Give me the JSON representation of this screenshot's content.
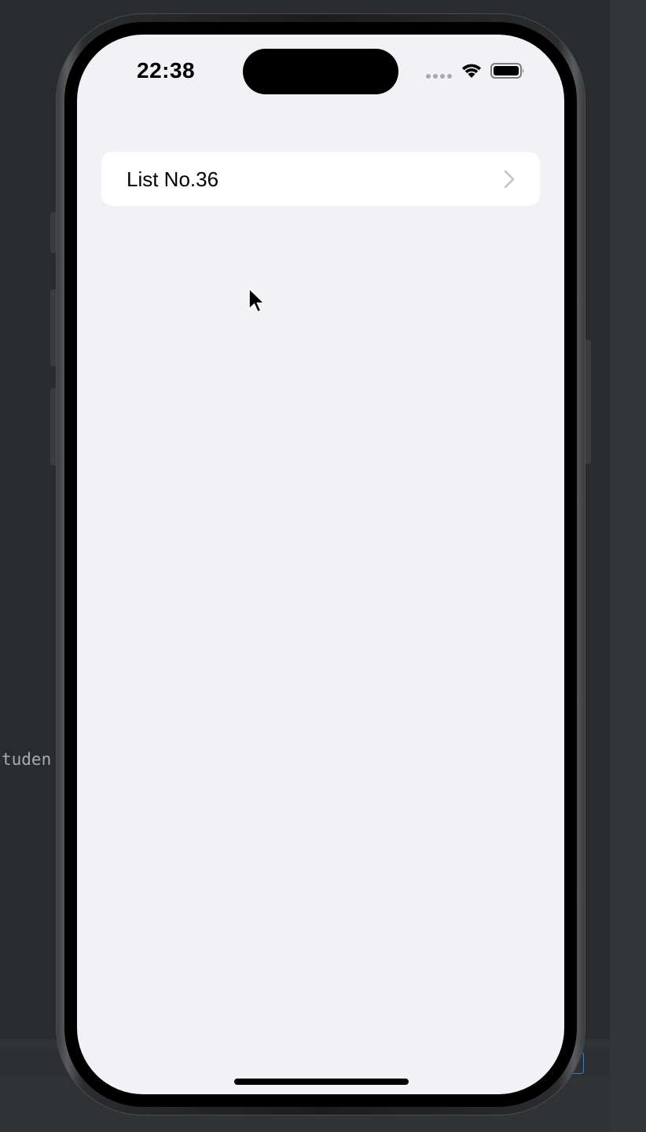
{
  "status_bar": {
    "time": "22:38",
    "signal_icon": "cellular-signal-icon",
    "wifi_icon": "wifi-icon",
    "battery_icon": "battery-full-icon"
  },
  "list": {
    "items": [
      {
        "label": "List No.36",
        "icon": "chevron-right-icon"
      }
    ]
  },
  "background_editor": {
    "code_fragment": "tuden"
  },
  "colors": {
    "screen_background": "#f1f1f6",
    "card_background": "#ffffff",
    "chevron": "#c4c4c7"
  }
}
